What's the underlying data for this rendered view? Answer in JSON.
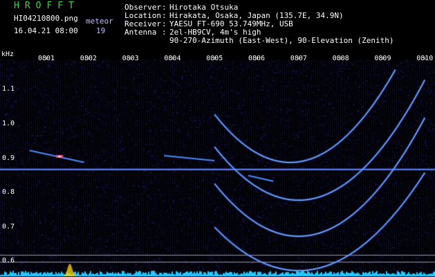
{
  "header": {
    "logo": "HROFFT",
    "filename": "HI04210800.png",
    "datetime": "16.04.21 08:00",
    "meteor_label": "meteor",
    "meteor_count": "19",
    "observer_label": "Observer",
    "observer_value": "Hirotaka Otsuka",
    "location_label": "Location",
    "location_value": "Hirakata, Osaka, Japan (135.7E, 34.9N)",
    "receiver_label": "Receiver",
    "receiver_value": "YAESU FT-690 53.749MHz, USB",
    "antenna_label": "Antenna",
    "antenna_value": "2el-HB9CV, 4m's high",
    "antenna_value2": "90-270-Azimuth (East-West), 90-Elevation (Zenith)"
  },
  "colors": {
    "background": "#000000",
    "noise": "#1a1a6e",
    "trace": "#4a8cff",
    "trace_core": "#c8f4ff",
    "logo": "#33dd44",
    "spectrum_bar": "#22c8ff",
    "spectrum_peak": "#ffe000",
    "echo_hot": "#ff4477"
  },
  "chart_data": {
    "type": "heatmap",
    "ylabel": "kHz",
    "x_ticks": [
      "0801",
      "0802",
      "0803",
      "0804",
      "0805",
      "0806",
      "0807",
      "0808",
      "0809",
      "0810"
    ],
    "y_ticks": [
      "1.1",
      "1.0",
      "0.9",
      "0.8",
      "0.7",
      "0.6"
    ],
    "x_range_minutes": [
      0.5,
      10
    ],
    "y_range_khz": [
      0.57,
      1.2
    ],
    "carrier_khz": 0.87,
    "meteor_echoes": [
      {
        "start": 0.6,
        "end": 1.9,
        "freq_start": 0.925,
        "freq_end": 0.89
      },
      {
        "start": 3.8,
        "end": 5.0,
        "freq_start": 0.91,
        "freq_end": 0.895
      },
      {
        "start": 5.8,
        "end": 6.4,
        "freq_start": 0.852,
        "freq_end": 0.835
      }
    ],
    "doppler_tracks": [
      {
        "start": 5.0,
        "end": 9.3,
        "min_time": 6.8,
        "min_khz": 0.89,
        "end_khz": 1.16
      },
      {
        "start": 5.0,
        "end": 10.0,
        "min_time": 7.0,
        "min_khz": 0.78,
        "end_khz": 1.13
      },
      {
        "start": 5.0,
        "end": 10.0,
        "min_time": 7.0,
        "min_khz": 0.675,
        "end_khz": 1.02
      },
      {
        "start": 5.0,
        "end": 10.0,
        "min_time": 7.0,
        "min_khz": 0.575,
        "end_khz": 0.86
      }
    ],
    "reference_lines_khz": [
      0.62,
      0.6
    ]
  }
}
